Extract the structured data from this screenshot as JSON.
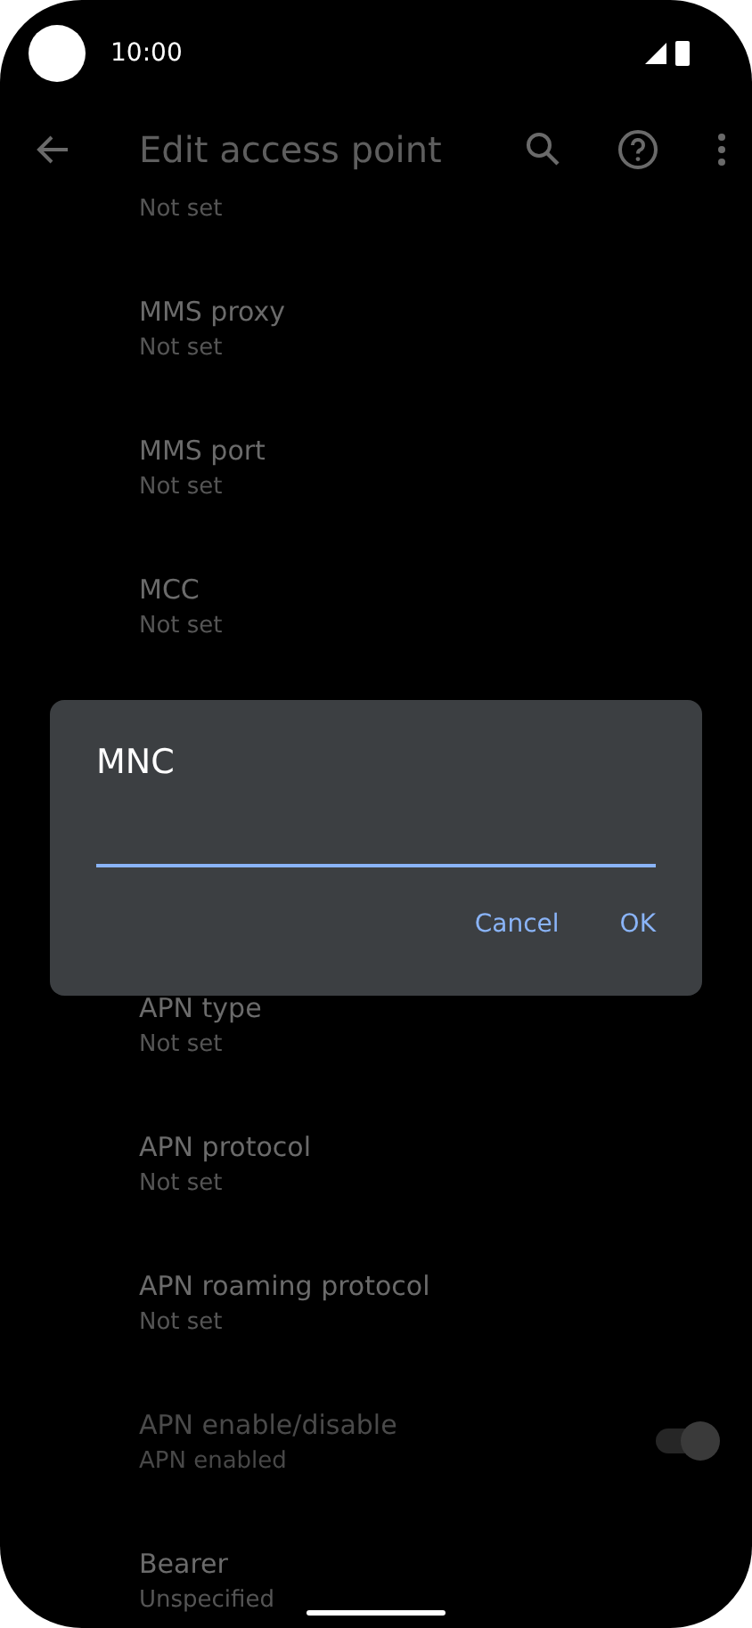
{
  "status_bar": {
    "time": "10:00"
  },
  "toolbar": {
    "title": "Edit access point"
  },
  "list_top": [
    {
      "subtitle": "Not set"
    },
    {
      "title": "MMS proxy",
      "subtitle": "Not set"
    },
    {
      "title": "MMS port",
      "subtitle": "Not set"
    },
    {
      "title": "MCC",
      "subtitle": "Not set"
    }
  ],
  "dialog": {
    "title": "MNC",
    "buttons": [
      "Cancel",
      "OK"
    ]
  },
  "list_bottom": [
    {
      "kind": "text",
      "title": "APN type",
      "subtitle": "Not set",
      "disabled": false
    },
    {
      "kind": "text",
      "title": "APN protocol",
      "subtitle": "Not set",
      "disabled": false
    },
    {
      "kind": "text",
      "title": "APN roaming protocol",
      "subtitle": "Not set",
      "disabled": false
    },
    {
      "kind": "switch",
      "title": "APN enable/disable",
      "subtitle": "APN enabled",
      "disabled": true,
      "on": true
    },
    {
      "kind": "text",
      "title": "Bearer",
      "subtitle": "Unspecified",
      "disabled": false
    }
  ]
}
